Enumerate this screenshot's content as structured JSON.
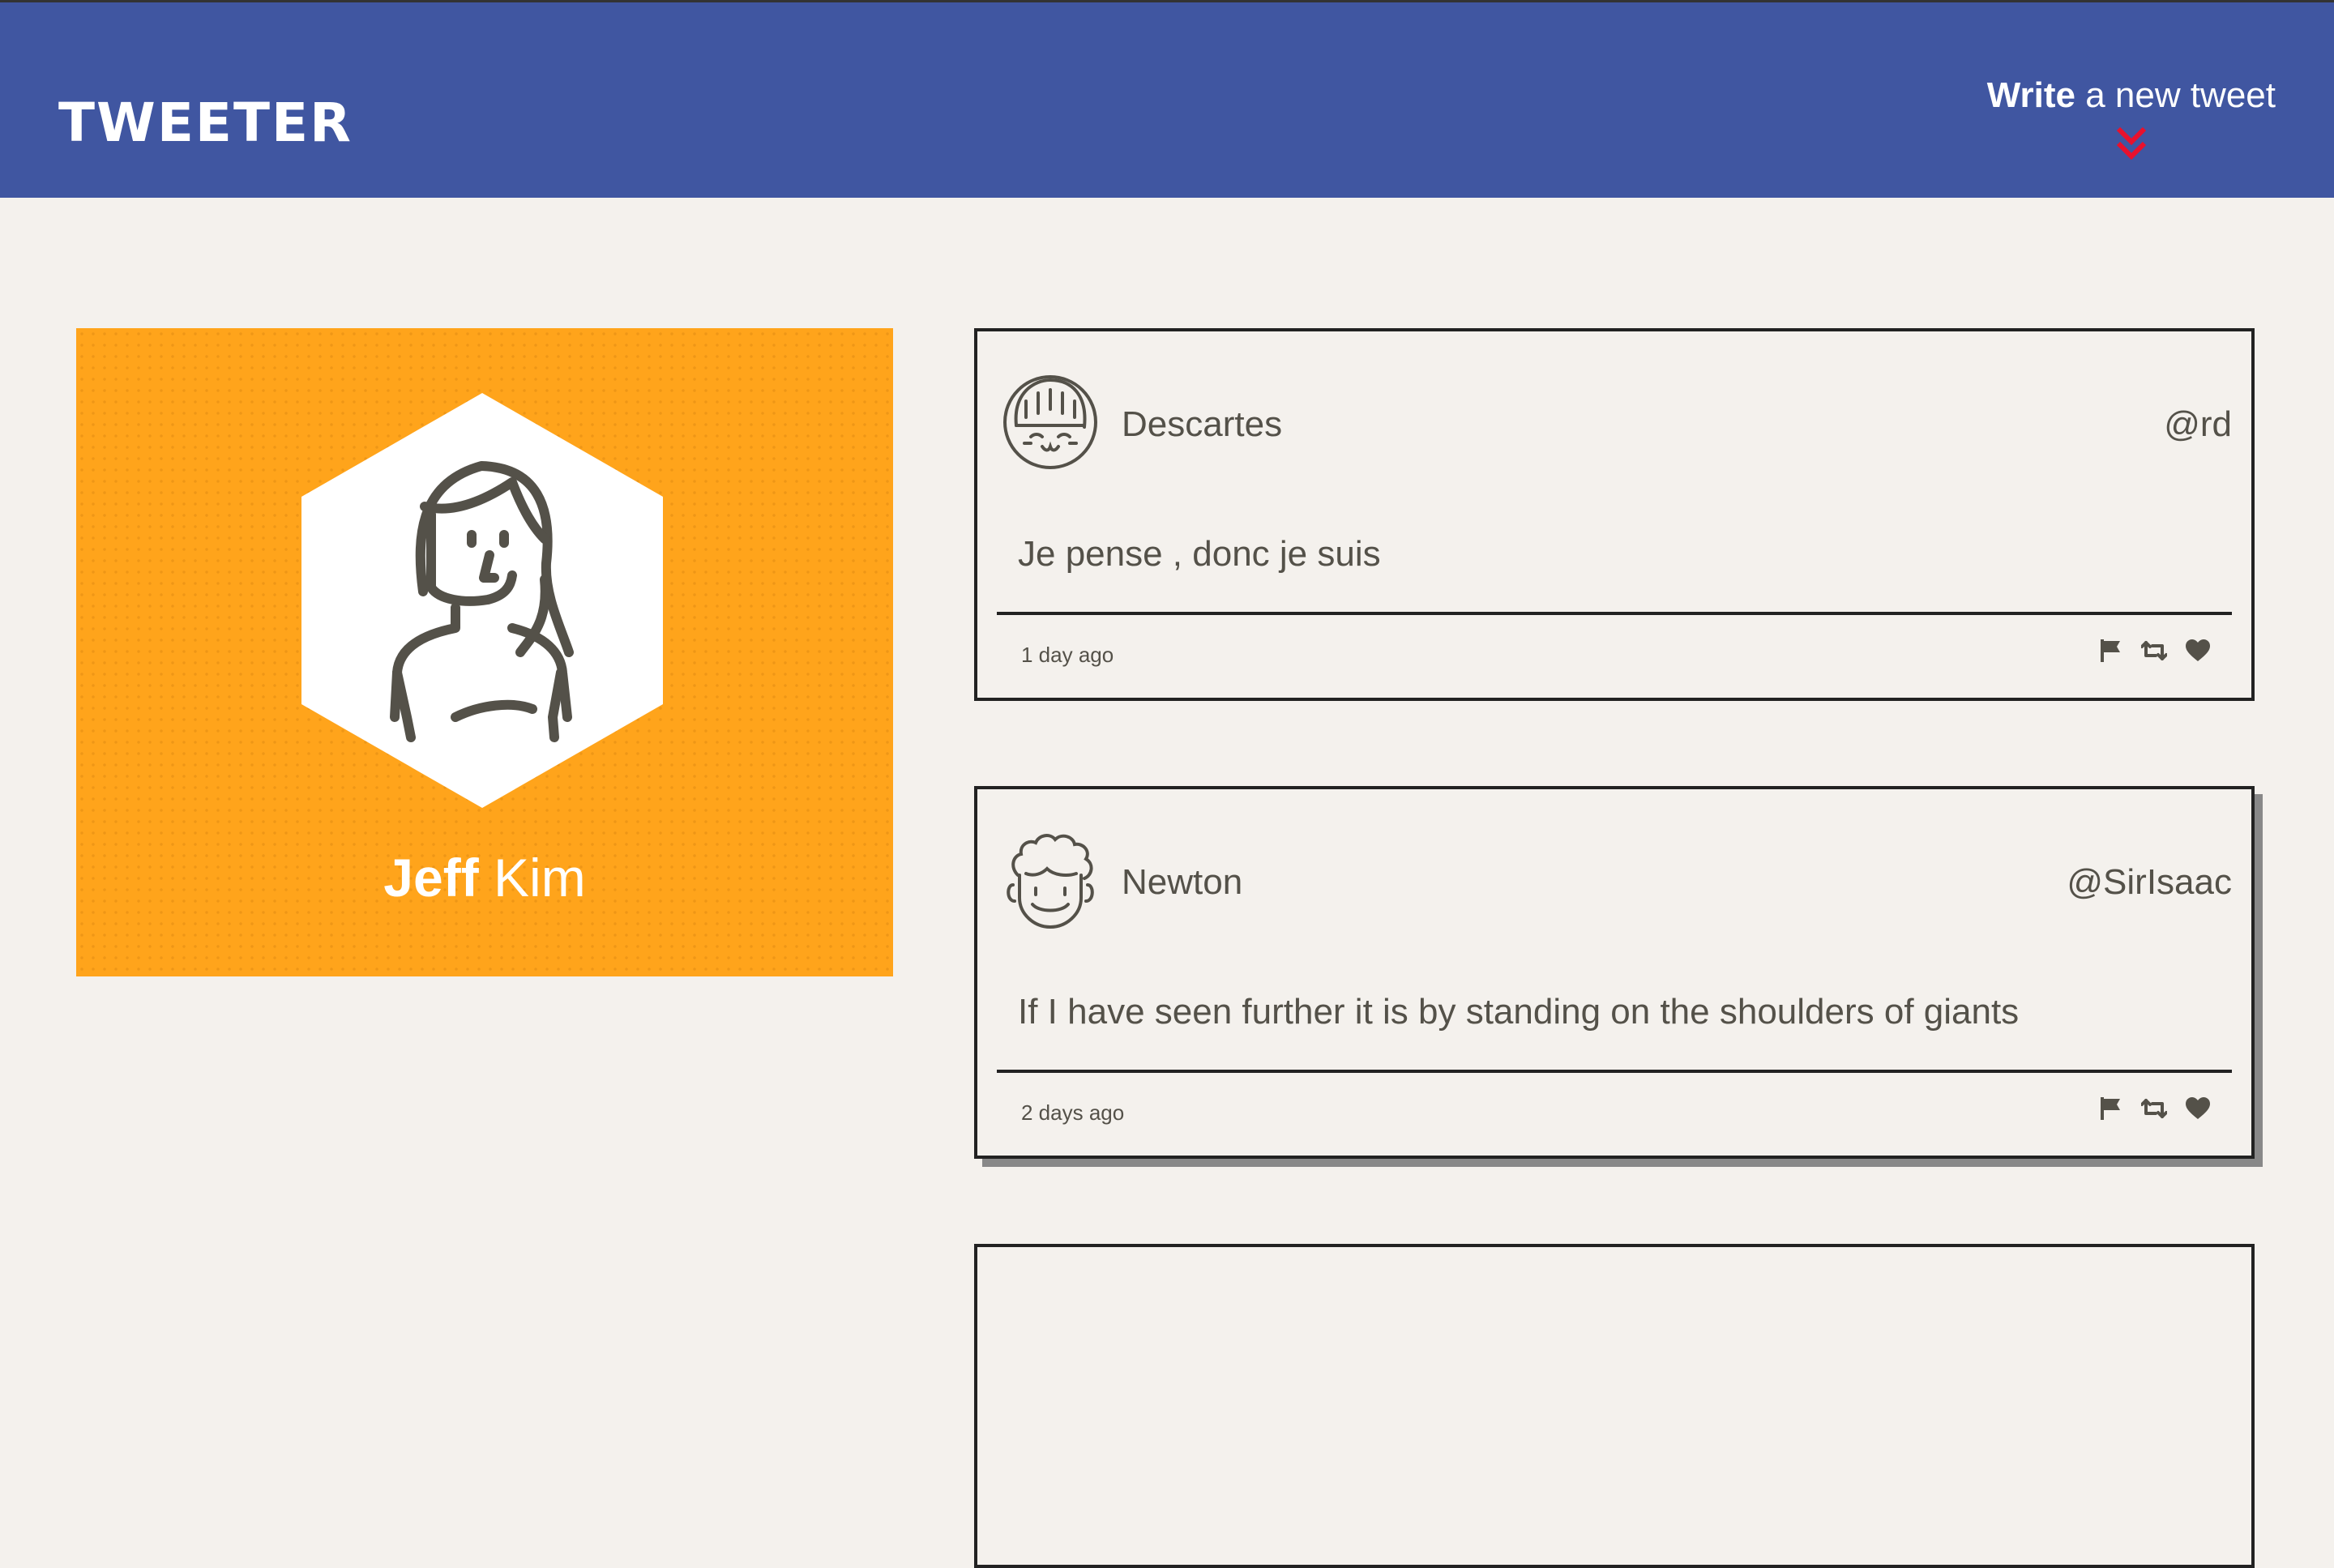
{
  "nav": {
    "brand": "Tweeter",
    "compose_bold": "Write",
    "compose_rest": " a new tweet",
    "compose_arrow_icon": "double-chevron-down-icon",
    "arrow_color": "#e8112d"
  },
  "profile": {
    "first_name": "Jeff",
    "last_name": "Kim",
    "avatar_icon": "woman-avatar-icon",
    "card_color": "#ffa41b"
  },
  "tweets": [
    {
      "name": "Descartes",
      "handle": "@rd",
      "text": "Je pense , donc je suis",
      "time": "1 day ago",
      "avatar_icon": "girl-avatar-icon"
    },
    {
      "name": "Newton",
      "handle": "@SirIsaac",
      "text": "If I have seen further it is by standing on the shoulders of giants",
      "time": "2 days ago",
      "avatar_icon": "curly-hair-avatar-icon"
    }
  ],
  "actions": [
    "flag-icon",
    "retweet-icon",
    "heart-icon"
  ],
  "colors": {
    "nav": "#4056a1",
    "background": "#f4f1ed",
    "text": "#545149"
  }
}
